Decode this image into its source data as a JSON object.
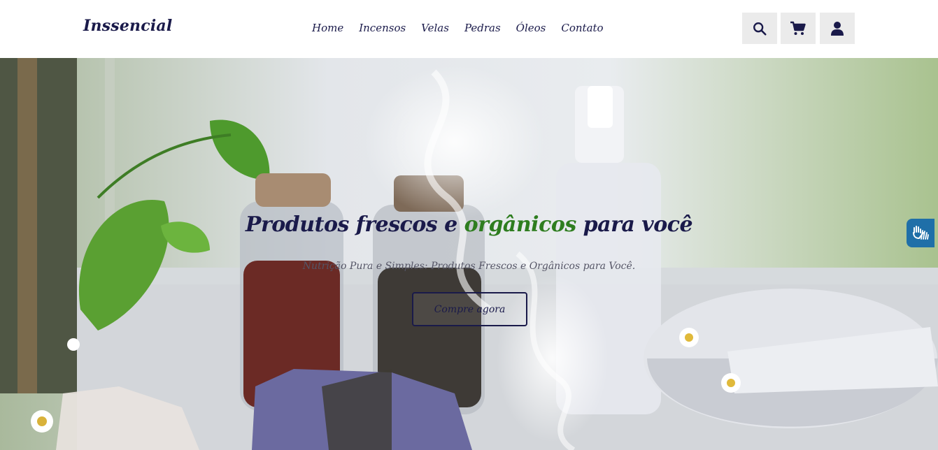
{
  "header": {
    "logo": "Inssencial",
    "nav": [
      {
        "label": "Home"
      },
      {
        "label": "Incensos"
      },
      {
        "label": "Velas"
      },
      {
        "label": "Pedras"
      },
      {
        "label": "Óleos"
      },
      {
        "label": "Contato"
      }
    ],
    "actions": {
      "search_icon": "search-icon",
      "cart_icon": "cart-icon",
      "user_icon": "user-icon"
    }
  },
  "hero": {
    "title_part1": "Produtos frescos e ",
    "title_highlight": "orgânicos",
    "title_part2": " para você",
    "subtitle": "Nutrição Pura e Simples: Produtos Frescos e Orgânicos para Você.",
    "cta_label": "Compre agora"
  },
  "accessibility": {
    "icon": "sign-language-icon"
  },
  "colors": {
    "primary": "#1a1a4a",
    "highlight": "#2e7d1f",
    "icon_button_bg": "#ebebeb",
    "accessibility_bg": "#1f6fa8"
  }
}
